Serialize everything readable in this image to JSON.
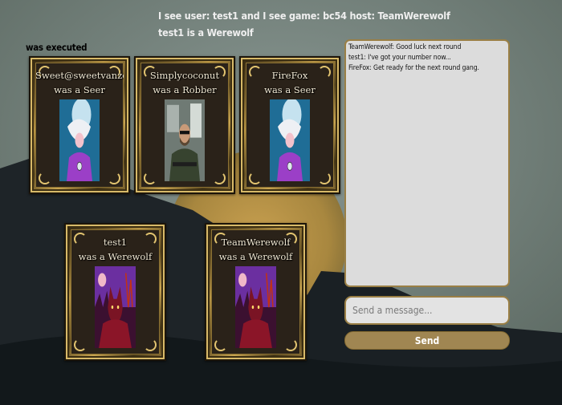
{
  "header": {
    "status_line": "I see user: test1 and I see game: bc54 host: TeamWerewolf",
    "result_line": "test1 is a Werewolf"
  },
  "executed_label": "was executed",
  "cards": [
    {
      "name": "Sweet@sweetvanzoa...",
      "role": "was a Seer",
      "art": "seer"
    },
    {
      "name": "Simplycoconut",
      "role": "was a Robber",
      "art": "robber"
    },
    {
      "name": "FireFox",
      "role": "was a Seer",
      "art": "seer"
    },
    {
      "name": "test1",
      "role": "was a Werewolf",
      "art": "werewolf"
    },
    {
      "name": "TeamWerewolf",
      "role": "was a Werewolf",
      "art": "werewolf"
    }
  ],
  "chat": {
    "messages": [
      "TeamWerewolf:  Good luck next round",
      "test1:  I've got your number now...",
      "FireFox:  Get ready for the next round gang."
    ],
    "input_placeholder": "Send a message...",
    "send_label": "Send"
  },
  "colors": {
    "accent_gold": "#a08652",
    "chat_bg": "#dcdcdc"
  }
}
